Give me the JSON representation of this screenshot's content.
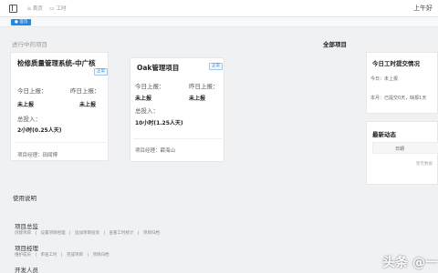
{
  "topbar": {
    "tabs": [
      {
        "icon": "home-icon",
        "label": "首页"
      },
      {
        "icon": "briefcase-icon",
        "label": "工时"
      }
    ],
    "right_text": "上午好"
  },
  "tabstrip": {
    "active_tab": "● 首页"
  },
  "progress_section": {
    "label": "进行中的项目",
    "all_projects_link": "全部项目"
  },
  "projects": [
    {
      "title": "检修质量管理系统-中广核",
      "badge": "正常",
      "today_label": "今日上报：",
      "yesterday_label": "昨日上报：",
      "today_value": "未上报",
      "yesterday_value": "未上报",
      "total_label": "总投入：",
      "total_value": "2小时(0.25人天)",
      "manager": "项目经理：田闻博"
    },
    {
      "title": "Oak管理项目",
      "badge": "正常",
      "today_label": "今日上报：",
      "yesterday_label": "昨日上报：",
      "today_value": "未上报",
      "yesterday_value": "未上报",
      "total_label": "总投入：",
      "total_value": "10小时(1.25人天)",
      "manager": "项目经理：薛海山"
    }
  ],
  "today_status": {
    "title": "今日工时提交情况",
    "line1": "今日：未上报",
    "line2": "本月：已提交0天，缺报1天"
  },
  "latest_activity": {
    "title": "最新动态",
    "column": "日期",
    "empty_text": "暂无数据"
  },
  "usage": {
    "title": "使用说明",
    "groups": [
      {
        "title": "项目总监",
        "links": "创建项目　|　设置项目经理　|　追加项目投资　|　查看工时统计　|　项目归档"
      },
      {
        "title": "项目经理",
        "links": "维护成员　|　审查工时　|　完成项目　|　项目归档"
      },
      {
        "title": "开发人员",
        "links": ""
      }
    ]
  },
  "watermark": "头条 @一"
}
